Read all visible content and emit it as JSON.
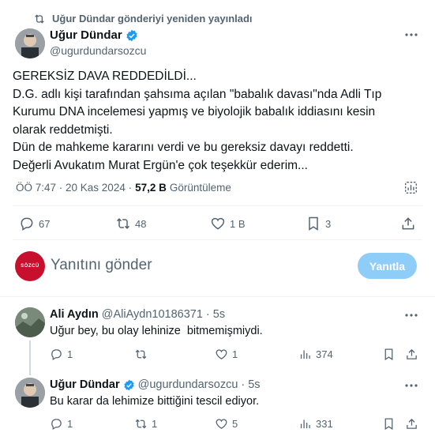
{
  "repost_banner": {
    "text": "Uğur Dündar gönderiyi yeniden yayınladı"
  },
  "main_tweet": {
    "author_name": "Uğur Dündar",
    "handle": "@ugurdundarsozcu",
    "lines": [
      "GEREKSİZ DAVA REDDEDİLDİ...",
      "D.G. adlı kişi tarafından şahsıma açılan \"babalık davası\"nda Adli Tıp",
      "Kurumu DNA incelemesi yapmış ve biyolojik babalık iddiasını kesin",
      "olarak reddetmişti.",
      "Dün de mahkeme kararını verdi ve bu gereksiz davayı reddetti.",
      "Değerli Avukatım Murat Ergün'e çok teşekkür ederim..."
    ],
    "time": "ÖÖ 7:47 · 20 Kas 2024 ·",
    "views_count": "57,2 B",
    "views_label": "Görüntüleme",
    "stats": {
      "replies": "67",
      "reposts": "48",
      "likes": "1 B",
      "bookmarks": "3"
    }
  },
  "reply_composer": {
    "placeholder": "Yanıtını gönder",
    "button_label": "Yanıtla",
    "avatar_text": "SÖZCÜ"
  },
  "replies": [
    {
      "author_name": "Ali Aydın",
      "handle": "@AliAydn10186371",
      "time": "· 5s",
      "text": "Uğur bey, bu olay lehinize  bitmemişmiydi.",
      "stats": {
        "replies": "1",
        "reposts": "",
        "likes": "1",
        "views": "374"
      }
    },
    {
      "author_name": "Uğur Dündar",
      "handle": "@ugurdundarsozcu",
      "time": "· 5s",
      "text": "Bu karar da lehimize bittiğini tescil ediyor.",
      "stats": {
        "replies": "1",
        "reposts": "1",
        "likes": "5",
        "views": "331"
      }
    }
  ],
  "colors": {
    "accent": "#1d9bf0",
    "reply_button": "#8ecdf7",
    "muted": "#536471",
    "divider": "#eff3f4"
  }
}
